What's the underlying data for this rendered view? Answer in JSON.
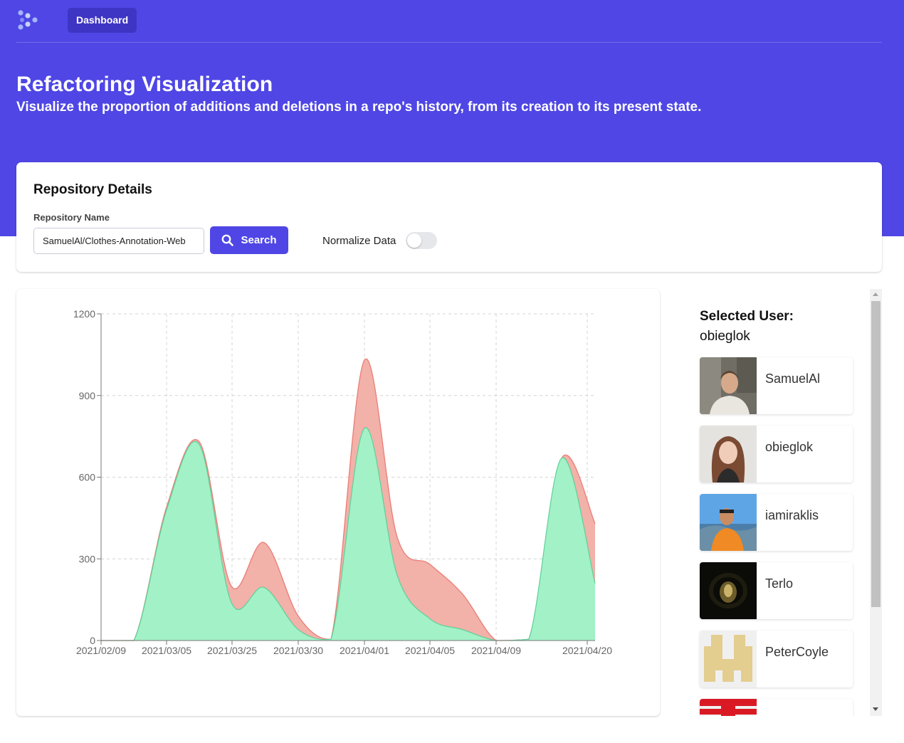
{
  "header": {
    "nav_button": "Dashboard",
    "title": "Refactoring Visualization",
    "subtitle": "Visualize the proportion of additions and deletions in a repo's history, from its creation to its present state."
  },
  "repository": {
    "heading": "Repository Details",
    "field_label": "Repository Name",
    "field_value": "SamuelAl/Clothes-Annotation-Web",
    "search_label": "Search",
    "normalize_label": "Normalize Data",
    "normalize_on": false
  },
  "colors": {
    "brand": "#4f46e5",
    "additions": "#a3f1c7",
    "additions_stroke": "#5bd199",
    "deletions": "#f2b1a9",
    "deletions_stroke": "#e97e76"
  },
  "chart_data": {
    "type": "area",
    "x": [
      "2021/02/09",
      "2021/03/05",
      "2021/03/25",
      "2021/03/30",
      "2021/04/01",
      "2021/04/05",
      "2021/04/09",
      "2021/04/20"
    ],
    "ylim": [
      0,
      1200
    ],
    "yticks": [
      0,
      300,
      600,
      900,
      1200
    ],
    "grid": true,
    "series": [
      {
        "role": "total",
        "values": [
          0,
          0,
          490,
          730,
          200,
          360,
          90,
          5,
          1030,
          380,
          280,
          170,
          0,
          5,
          670,
          430
        ]
      },
      {
        "role": "additions",
        "values": [
          0,
          0,
          480,
          720,
          140,
          195,
          40,
          5,
          780,
          240,
          80,
          40,
          0,
          5,
          670,
          210
        ]
      }
    ]
  },
  "side": {
    "selected_title": "Selected User:",
    "selected_user": "obieglok",
    "users": [
      {
        "name": "SamuelAl",
        "avatar": "man-photo"
      },
      {
        "name": "obieglok",
        "avatar": "woman-photo"
      },
      {
        "name": "iamiraklis",
        "avatar": "man-orange-shirt-photo"
      },
      {
        "name": "Terlo",
        "avatar": "dark-moth-photo"
      },
      {
        "name": "PeterCoyle",
        "avatar": "identicon"
      },
      {
        "name": "",
        "avatar": "red-identicon"
      }
    ]
  }
}
